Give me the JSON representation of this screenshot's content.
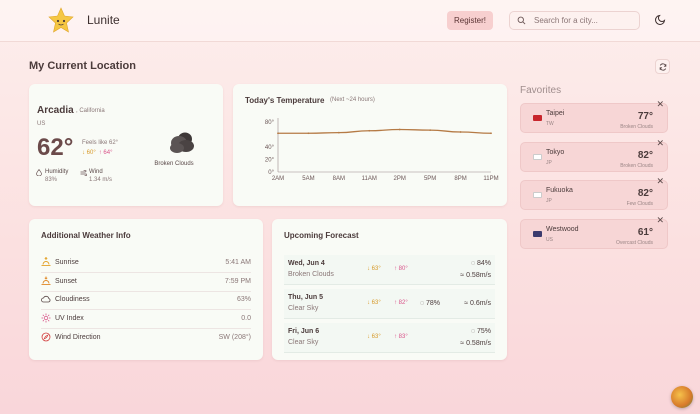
{
  "app": {
    "name": "Lunite"
  },
  "header": {
    "register_label": "Register!",
    "search_placeholder": "Search for a city..."
  },
  "page_title": "My Current Location",
  "current": {
    "city": "Arcadia",
    "state": ", California",
    "country": "US",
    "temp": "62°",
    "feels_like": "Feels like 62°",
    "low": "↓ 60°",
    "high": "↑ 64°",
    "condition": "Broken Clouds",
    "humidity_label": "Humidity",
    "humidity_value": "83%",
    "wind_label": "Wind",
    "wind_value": "1.34 m/s"
  },
  "temperature_chart": {
    "title": "Today's Temperature",
    "subtitle": "(Next ~24 hours)"
  },
  "chart_data": {
    "type": "line",
    "title": "Today's Temperature",
    "x": [
      "2AM",
      "5AM",
      "8AM",
      "11AM",
      "2PM",
      "5PM",
      "8PM",
      "11PM"
    ],
    "series": [
      {
        "values": [
          62,
          62,
          63,
          66,
          68,
          67,
          64,
          62
        ]
      }
    ],
    "yticks": [
      "80°",
      "40°",
      "20°",
      "0°"
    ],
    "ylim": [
      0,
      80
    ],
    "line_color": "#b57a45"
  },
  "additional": {
    "title": "Additional Weather Info",
    "rows": [
      {
        "label": "Sunrise",
        "value": "5:41 AM",
        "icon": "sunrise-icon"
      },
      {
        "label": "Sunset",
        "value": "7:59 PM",
        "icon": "sunset-icon"
      },
      {
        "label": "Cloudiness",
        "value": "63%",
        "icon": "cloud-icon"
      },
      {
        "label": "UV Index",
        "value": "0.0",
        "icon": "uv-icon"
      },
      {
        "label": "Wind Direction",
        "value": "SW (208°)",
        "icon": "compass-icon"
      }
    ]
  },
  "forecast": {
    "title": "Upcoming Forecast",
    "days": [
      {
        "date": "Wed, Jun 4",
        "condition": "Broken Clouds",
        "low": "↓ 63°",
        "high": "↑ 80°",
        "humidity": "84%",
        "wind": "0.58m/s"
      },
      {
        "date": "Thu, Jun 5",
        "condition": "Clear Sky",
        "low": "↓ 63°",
        "high": "↑ 82°",
        "humidity": "78%",
        "wind": "0.6m/s"
      },
      {
        "date": "Fri, Jun 6",
        "condition": "Clear Sky",
        "low": "↓ 63°",
        "high": "↑ 83°",
        "humidity": "75%",
        "wind": "0.58m/s"
      }
    ]
  },
  "favorites": {
    "title": "Favorites",
    "items": [
      {
        "name": "Taipei",
        "country": "TW",
        "temp": "77°",
        "desc": "Broken Clouds",
        "flag": "#c8252c"
      },
      {
        "name": "Tokyo",
        "country": "JP",
        "temp": "82°",
        "desc": "Broken Clouds",
        "flag": "#ffffff"
      },
      {
        "name": "Fukuoka",
        "country": "JP",
        "temp": "82°",
        "desc": "Few Clouds",
        "flag": "#ffffff"
      },
      {
        "name": "Westwood",
        "country": "US",
        "temp": "61°",
        "desc": "Overcast Clouds",
        "flag": "#3c3b6e"
      }
    ]
  },
  "colors": {
    "accent": "#f7cfcf",
    "low": "#d79a2a",
    "high": "#d9548a"
  }
}
